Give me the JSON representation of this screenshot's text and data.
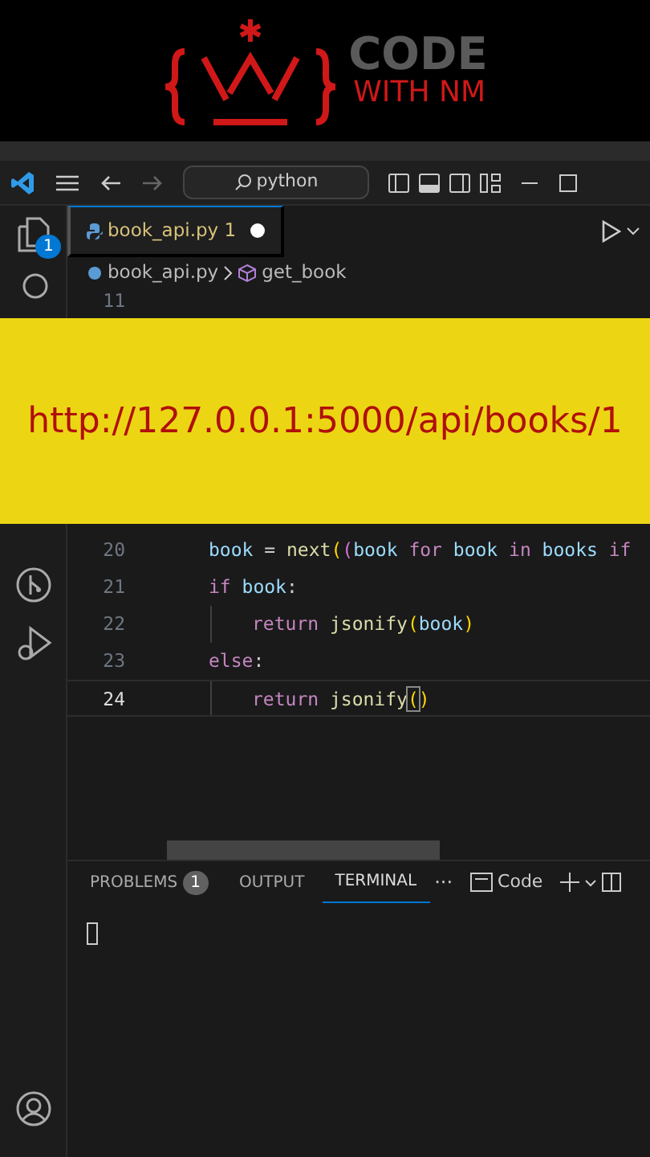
{
  "logo": {
    "line1": "CODE",
    "line2": "WITH NM"
  },
  "titlebar": {
    "search": "python"
  },
  "activity_badge": "1",
  "tab": {
    "label": "book_api.py",
    "problems": "1",
    "modified": true,
    "selected": true
  },
  "breadcrumb": [
    "book_api.py",
    "get_book"
  ],
  "editor_top_lines": [
    {
      "number": "11",
      "current": false
    }
  ],
  "banner": {
    "text": "http://127.0.0.1:5000/api/books/1"
  },
  "code_lines": [
    {
      "number": "20",
      "current": false,
      "kind": "body",
      "tokens": [
        {
          "kind": "var",
          "text": "book"
        },
        {
          "kind": "plain",
          "text": " = "
        },
        {
          "kind": "fn",
          "text": "next"
        },
        {
          "kind": "bracket",
          "text": "("
        },
        {
          "kind": "bracket2",
          "text": "("
        },
        {
          "kind": "var",
          "text": "book"
        },
        {
          "kind": "kw",
          "text": " for "
        },
        {
          "kind": "var",
          "text": "book"
        },
        {
          "kind": "kw",
          "text": " in "
        },
        {
          "kind": "var",
          "text": "books"
        },
        {
          "kind": "kw",
          "text": " if"
        }
      ]
    },
    {
      "number": "21",
      "current": false,
      "kind": "body",
      "tokens": [
        {
          "kind": "kw",
          "text": "if "
        },
        {
          "kind": "var",
          "text": "book"
        },
        {
          "kind": "plain",
          "text": ":"
        }
      ]
    },
    {
      "number": "22",
      "current": false,
      "kind": "nested",
      "tokens": [
        {
          "kind": "kw",
          "text": "return "
        },
        {
          "kind": "fn",
          "text": "jsonify"
        },
        {
          "kind": "bracket",
          "text": "("
        },
        {
          "kind": "var",
          "text": "book"
        },
        {
          "kind": "bracket",
          "text": ")"
        }
      ]
    },
    {
      "number": "23",
      "current": false,
      "kind": "body",
      "tokens": [
        {
          "kind": "kw",
          "text": "else"
        },
        {
          "kind": "plain",
          "text": ":"
        }
      ]
    },
    {
      "number": "24",
      "current": true,
      "kind": "nested",
      "tokens": [
        {
          "kind": "kw",
          "text": "return "
        },
        {
          "kind": "fn",
          "text": "jsonify"
        },
        {
          "kind": "match",
          "text": "("
        },
        {
          "kind": "bracket",
          "text": ")"
        }
      ]
    }
  ],
  "panel": {
    "tabs": [
      {
        "label": "PROBLEMS",
        "badge": "1",
        "selected": false
      },
      {
        "label": "OUTPUT",
        "selected": false
      },
      {
        "label": "TERMINAL",
        "selected": true
      }
    ],
    "more": "···",
    "profile": "Code"
  }
}
